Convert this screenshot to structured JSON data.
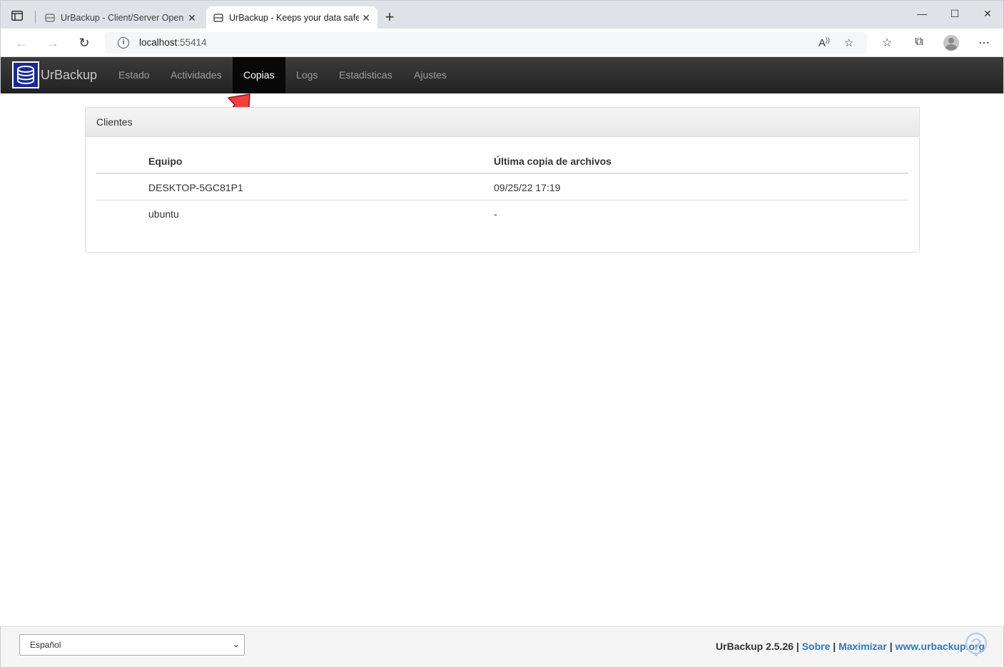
{
  "browser": {
    "tabs": [
      {
        "title": "UrBackup - Client/Server Open S",
        "active": false
      },
      {
        "title": "UrBackup - Keeps your data safe",
        "active": true
      }
    ],
    "new_tab": "+",
    "url_host": "localhost",
    "url_port": ":55414",
    "window_controls": {
      "minimize": "—",
      "maximize": "☐",
      "close": "✕"
    }
  },
  "app": {
    "brand": "UrBackup",
    "nav": [
      {
        "label": "Estado",
        "active": false
      },
      {
        "label": "Actividades",
        "active": false
      },
      {
        "label": "Copias",
        "active": true
      },
      {
        "label": "Logs",
        "active": false
      },
      {
        "label": "Estadisticas",
        "active": false
      },
      {
        "label": "Ajustes",
        "active": false
      }
    ]
  },
  "panel": {
    "heading": "Clientes",
    "columns": [
      "Equipo",
      "Última copia de archivos"
    ],
    "rows": [
      [
        "DESKTOP-5GC81P1",
        "09/25/22 17:19"
      ],
      [
        "ubuntu",
        "-"
      ]
    ]
  },
  "footer": {
    "language": "Español",
    "version": "UrBackup 2.5.26",
    "sep": "|",
    "links": [
      "Sobre",
      "Maximizar",
      "www.urbackup.org"
    ]
  },
  "colors": {
    "navbar": "#222222",
    "link": "#337ab7",
    "arrow": "#f04040"
  }
}
